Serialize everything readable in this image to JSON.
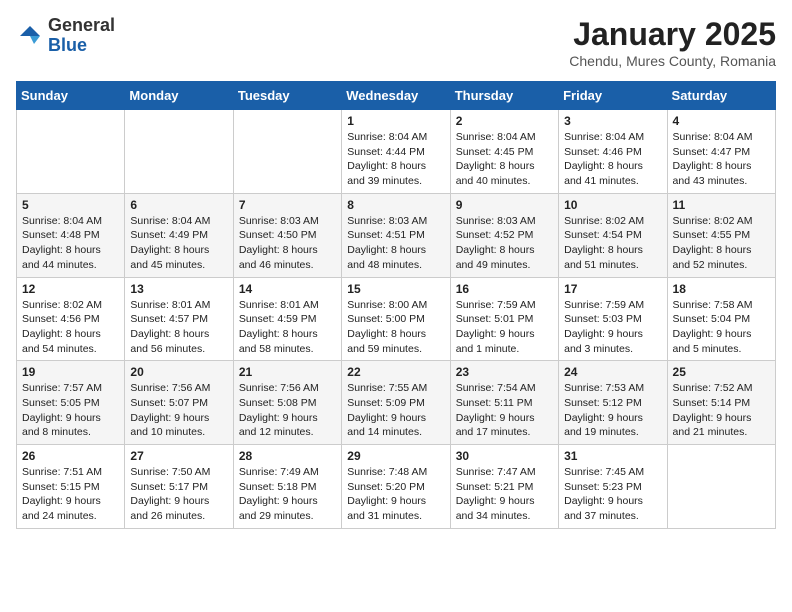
{
  "header": {
    "logo_general": "General",
    "logo_blue": "Blue",
    "title": "January 2025",
    "subtitle": "Chendu, Mures County, Romania"
  },
  "days_of_week": [
    "Sunday",
    "Monday",
    "Tuesday",
    "Wednesday",
    "Thursday",
    "Friday",
    "Saturday"
  ],
  "weeks": [
    [
      {
        "day": "",
        "info": ""
      },
      {
        "day": "",
        "info": ""
      },
      {
        "day": "",
        "info": ""
      },
      {
        "day": "1",
        "info": "Sunrise: 8:04 AM\nSunset: 4:44 PM\nDaylight: 8 hours and 39 minutes."
      },
      {
        "day": "2",
        "info": "Sunrise: 8:04 AM\nSunset: 4:45 PM\nDaylight: 8 hours and 40 minutes."
      },
      {
        "day": "3",
        "info": "Sunrise: 8:04 AM\nSunset: 4:46 PM\nDaylight: 8 hours and 41 minutes."
      },
      {
        "day": "4",
        "info": "Sunrise: 8:04 AM\nSunset: 4:47 PM\nDaylight: 8 hours and 43 minutes."
      }
    ],
    [
      {
        "day": "5",
        "info": "Sunrise: 8:04 AM\nSunset: 4:48 PM\nDaylight: 8 hours and 44 minutes."
      },
      {
        "day": "6",
        "info": "Sunrise: 8:04 AM\nSunset: 4:49 PM\nDaylight: 8 hours and 45 minutes."
      },
      {
        "day": "7",
        "info": "Sunrise: 8:03 AM\nSunset: 4:50 PM\nDaylight: 8 hours and 46 minutes."
      },
      {
        "day": "8",
        "info": "Sunrise: 8:03 AM\nSunset: 4:51 PM\nDaylight: 8 hours and 48 minutes."
      },
      {
        "day": "9",
        "info": "Sunrise: 8:03 AM\nSunset: 4:52 PM\nDaylight: 8 hours and 49 minutes."
      },
      {
        "day": "10",
        "info": "Sunrise: 8:02 AM\nSunset: 4:54 PM\nDaylight: 8 hours and 51 minutes."
      },
      {
        "day": "11",
        "info": "Sunrise: 8:02 AM\nSunset: 4:55 PM\nDaylight: 8 hours and 52 minutes."
      }
    ],
    [
      {
        "day": "12",
        "info": "Sunrise: 8:02 AM\nSunset: 4:56 PM\nDaylight: 8 hours and 54 minutes."
      },
      {
        "day": "13",
        "info": "Sunrise: 8:01 AM\nSunset: 4:57 PM\nDaylight: 8 hours and 56 minutes."
      },
      {
        "day": "14",
        "info": "Sunrise: 8:01 AM\nSunset: 4:59 PM\nDaylight: 8 hours and 58 minutes."
      },
      {
        "day": "15",
        "info": "Sunrise: 8:00 AM\nSunset: 5:00 PM\nDaylight: 8 hours and 59 minutes."
      },
      {
        "day": "16",
        "info": "Sunrise: 7:59 AM\nSunset: 5:01 PM\nDaylight: 9 hours and 1 minute."
      },
      {
        "day": "17",
        "info": "Sunrise: 7:59 AM\nSunset: 5:03 PM\nDaylight: 9 hours and 3 minutes."
      },
      {
        "day": "18",
        "info": "Sunrise: 7:58 AM\nSunset: 5:04 PM\nDaylight: 9 hours and 5 minutes."
      }
    ],
    [
      {
        "day": "19",
        "info": "Sunrise: 7:57 AM\nSunset: 5:05 PM\nDaylight: 9 hours and 8 minutes."
      },
      {
        "day": "20",
        "info": "Sunrise: 7:56 AM\nSunset: 5:07 PM\nDaylight: 9 hours and 10 minutes."
      },
      {
        "day": "21",
        "info": "Sunrise: 7:56 AM\nSunset: 5:08 PM\nDaylight: 9 hours and 12 minutes."
      },
      {
        "day": "22",
        "info": "Sunrise: 7:55 AM\nSunset: 5:09 PM\nDaylight: 9 hours and 14 minutes."
      },
      {
        "day": "23",
        "info": "Sunrise: 7:54 AM\nSunset: 5:11 PM\nDaylight: 9 hours and 17 minutes."
      },
      {
        "day": "24",
        "info": "Sunrise: 7:53 AM\nSunset: 5:12 PM\nDaylight: 9 hours and 19 minutes."
      },
      {
        "day": "25",
        "info": "Sunrise: 7:52 AM\nSunset: 5:14 PM\nDaylight: 9 hours and 21 minutes."
      }
    ],
    [
      {
        "day": "26",
        "info": "Sunrise: 7:51 AM\nSunset: 5:15 PM\nDaylight: 9 hours and 24 minutes."
      },
      {
        "day": "27",
        "info": "Sunrise: 7:50 AM\nSunset: 5:17 PM\nDaylight: 9 hours and 26 minutes."
      },
      {
        "day": "28",
        "info": "Sunrise: 7:49 AM\nSunset: 5:18 PM\nDaylight: 9 hours and 29 minutes."
      },
      {
        "day": "29",
        "info": "Sunrise: 7:48 AM\nSunset: 5:20 PM\nDaylight: 9 hours and 31 minutes."
      },
      {
        "day": "30",
        "info": "Sunrise: 7:47 AM\nSunset: 5:21 PM\nDaylight: 9 hours and 34 minutes."
      },
      {
        "day": "31",
        "info": "Sunrise: 7:45 AM\nSunset: 5:23 PM\nDaylight: 9 hours and 37 minutes."
      },
      {
        "day": "",
        "info": ""
      }
    ]
  ]
}
